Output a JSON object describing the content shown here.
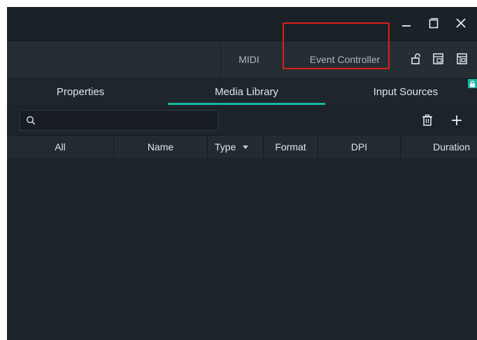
{
  "window": {
    "controls": {
      "minimize": "minimize-icon",
      "maximize": "restore-icon",
      "close": "close-icon"
    }
  },
  "panel_tabs": {
    "midi_label": "MIDI",
    "event_label": "Event Controller",
    "icons": [
      "unlock-icon",
      "dock-panel-icon",
      "float-panel-icon"
    ]
  },
  "section_tabs": {
    "properties": "Properties",
    "media_library": "Media Library",
    "input_sources": "Input Sources",
    "active": "Media Library"
  },
  "toolbar": {
    "search_placeholder": "",
    "search_value": "",
    "icons": [
      "search-icon",
      "trash-icon",
      "plus-icon"
    ]
  },
  "table": {
    "columns": [
      "All",
      "Name",
      "Type",
      "Format",
      "DPI",
      "Duration"
    ],
    "rows": []
  },
  "colors": {
    "background": "#1c2329",
    "accent": "#19b6a2",
    "highlight_box": "#e21c1c"
  }
}
